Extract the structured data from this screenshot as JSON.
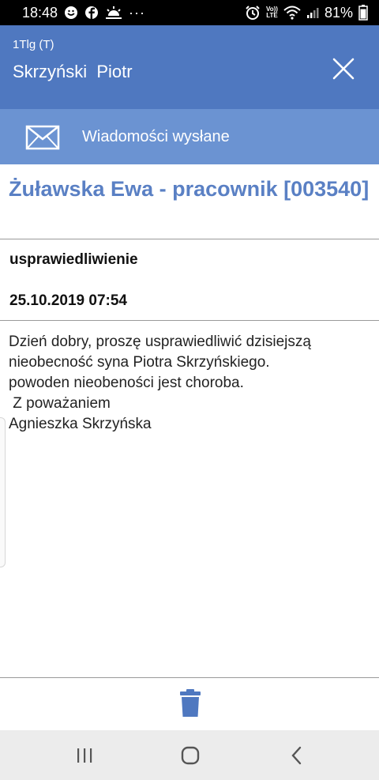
{
  "status_bar": {
    "time": "18:48",
    "battery": "81%",
    "left_icons": [
      "whatsapp-like-icon",
      "facebook-icon",
      "weather-icon",
      "more-dots-icon"
    ],
    "right_icons": [
      "alarm-icon",
      "volte-icon",
      "wifi-icon",
      "signal-icon",
      "battery-icon"
    ],
    "volte_label": "Vo)) LTE"
  },
  "header": {
    "class_label": "1Tlg (T)",
    "student_name": "Skrzyński  Piotr",
    "close_icon": "close-icon",
    "color": "#4f78c0"
  },
  "folder": {
    "label": "Wiadomości wysłane",
    "icon": "envelope-icon",
    "color": "#6b93d2"
  },
  "message": {
    "sender": "Żuławska Ewa - pracownik [003540]",
    "subject": "usprawiedliwienie",
    "datetime": "25.10.2019 07:54",
    "body_lines": [
      "Dzień dobry, proszę usprawiedliwić dzisiejszą",
      "nieobecność syna Piotra Skrzyńskiego.",
      "powoden nieobeności jest choroba.",
      " Z poważaniem",
      "Agnieszka Skrzyńska"
    ],
    "sender_color": "#5a80c4"
  },
  "toolbar": {
    "delete_icon": "trash-icon",
    "icon_color": "#4f78c0"
  },
  "nav": {
    "recents_icon": "recents-icon",
    "home_icon": "home-icon",
    "back_icon": "back-icon"
  }
}
